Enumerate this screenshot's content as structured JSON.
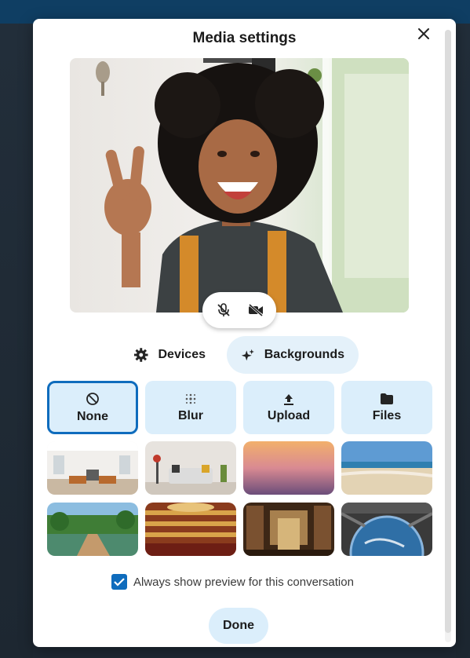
{
  "dialog": {
    "title": "Media settings",
    "close_icon": "close-icon"
  },
  "preview": {
    "controls": [
      {
        "name": "mic-off-icon",
        "state": "muted"
      },
      {
        "name": "camera-off-icon",
        "state": "off"
      }
    ]
  },
  "tabs": [
    {
      "label": "Devices",
      "icon": "gear-icon",
      "active": false
    },
    {
      "label": "Backgrounds",
      "icon": "sparkle-icon",
      "active": true
    }
  ],
  "options": [
    {
      "label": "None",
      "icon": "none-icon",
      "selected": true
    },
    {
      "label": "Blur",
      "icon": "blur-icon",
      "selected": false
    },
    {
      "label": "Upload",
      "icon": "upload-icon",
      "selected": false
    },
    {
      "label": "Files",
      "icon": "folder-icon",
      "selected": false
    }
  ],
  "backgrounds": [
    "office-loft",
    "living-room",
    "sunset-gradient",
    "beach",
    "garden-bridge",
    "opera-house",
    "library",
    "space-station"
  ],
  "preference": {
    "label": "Always show preview for this conversation",
    "checked": true
  },
  "footer": {
    "done_label": "Done"
  },
  "colors": {
    "accent": "#0f6cbd",
    "option_bg": "#dbeefb",
    "tab_active_bg": "#e4f1fa"
  }
}
